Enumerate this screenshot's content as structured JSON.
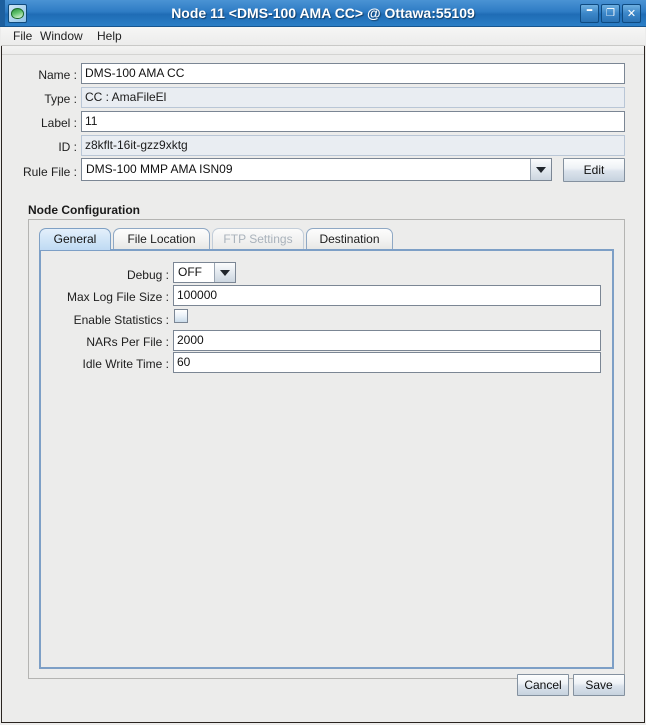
{
  "window": {
    "title": "Node 11 <DMS-100 AMA CC> @ Ottawa:55109",
    "app_icon": "node-app-icon",
    "controls": {
      "minimize": "–",
      "maximize": "❐",
      "close": "✕"
    },
    "accent_title_color": "#2e7cc4",
    "background_color": "#ececeb"
  },
  "menubar": {
    "items": [
      {
        "label": "File"
      },
      {
        "label": "Window"
      },
      {
        "label": "Help"
      }
    ]
  },
  "form": {
    "fields": [
      {
        "label": "Name :",
        "value": "DMS-100 AMA CC",
        "readonly": false
      },
      {
        "label": "Type :",
        "value": "CC : AmaFileEl",
        "readonly": true
      },
      {
        "label": "Label :",
        "value": "11",
        "readonly": false
      },
      {
        "label": "ID :",
        "value": "z8kflt-16it-gzz9xktg",
        "readonly": true
      }
    ],
    "rule_file": {
      "label": "Rule File :",
      "value": "DMS-100 MMP AMA ISN09",
      "dropdown_icon": "chevron-down-icon",
      "edit_label": "Edit"
    }
  },
  "node_configuration": {
    "title": "Node  Configuration",
    "tabs": [
      {
        "label": "General",
        "selected": true,
        "disabled": false
      },
      {
        "label": "File Location",
        "selected": false,
        "disabled": false
      },
      {
        "label": "FTP Settings",
        "selected": false,
        "disabled": true
      },
      {
        "label": "Destination",
        "selected": false,
        "disabled": false
      }
    ],
    "general": {
      "debug": {
        "label": "Debug :",
        "value": "OFF",
        "dropdown_icon": "chevron-down-icon"
      },
      "max_log_file_size": {
        "label": "Max Log File Size :",
        "value": "100000"
      },
      "enable_statistics": {
        "label": "Enable Statistics :",
        "checked": false
      },
      "nars_per_file": {
        "label": "NARs Per File :",
        "value": "2000"
      },
      "idle_write_time": {
        "label": "Idle Write Time :",
        "value": "60"
      }
    }
  },
  "footer": {
    "cancel_label": "Cancel",
    "save_label": "Save"
  }
}
